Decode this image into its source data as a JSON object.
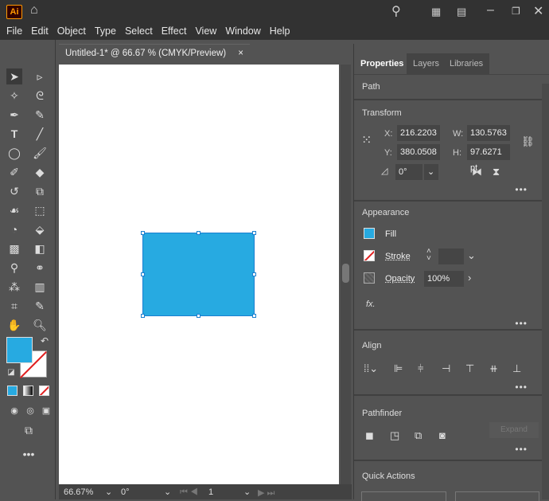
{
  "app": {
    "logo": "Ai"
  },
  "menu": [
    "File",
    "Edit",
    "Object",
    "Type",
    "Select",
    "Effect",
    "View",
    "Window",
    "Help"
  ],
  "document": {
    "tab_title": "Untitled-1* @ 66.67 % (CMYK/Preview)",
    "close": "×"
  },
  "colors": {
    "fill": "#27aae1",
    "accent": "#ff9a00"
  },
  "status": {
    "zoom": "66.67%",
    "rotation": "0°",
    "artboard": "1"
  },
  "panel": {
    "tabs": [
      "Properties",
      "Layers",
      "Libraries"
    ],
    "path_label": "Path",
    "transform": {
      "title": "Transform",
      "x_label": "X:",
      "x": "216.2203 p",
      "y_label": "Y:",
      "y": "380.0508 p",
      "w_label": "W:",
      "w": "130.5763 p",
      "h_label": "H:",
      "h": "97.6271 pt",
      "angle": "0°"
    },
    "appearance": {
      "title": "Appearance",
      "fill": "Fill",
      "stroke": "Stroke",
      "opacity_label": "Opacity",
      "opacity": "100%",
      "fx": "fx."
    },
    "align": {
      "title": "Align"
    },
    "pathfinder": {
      "title": "Pathfinder",
      "expand": "Expand"
    },
    "quick_actions": {
      "title": "Quick Actions"
    },
    "more": "•••"
  }
}
